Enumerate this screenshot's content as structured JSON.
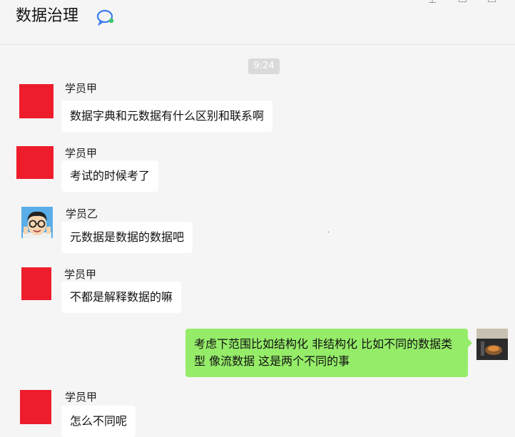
{
  "header": {
    "title": "数据治理",
    "chat_icon": "chat-bubble-icon"
  },
  "timestamp": "9:24",
  "messages": [
    {
      "sender": "学员甲",
      "text": "数据字典和元数据有什么区别和联系啊",
      "avatar": "red-square"
    },
    {
      "sender": "学员甲",
      "text": "考试的时候考了",
      "avatar": "red-square"
    },
    {
      "sender": "学员乙",
      "text": "元数据是数据的数据吧",
      "avatar": "cartoon-face"
    },
    {
      "sender": "学员甲",
      "text": "不都是解释数据的嘛",
      "avatar": "red-square"
    },
    {
      "sender": "self",
      "text": "考虑下范围比如结构化 非结构化 比如不同的数据类型 像流数据 这是两个不同的事",
      "avatar": "photo"
    },
    {
      "sender": "学员甲",
      "text": "怎么不同呢",
      "avatar": "red-square"
    }
  ],
  "colors": {
    "background": "#f5f5f5",
    "incoming_bubble": "#ffffff",
    "outgoing_bubble": "#95ec69",
    "avatar_red": "#ee1d2b"
  }
}
